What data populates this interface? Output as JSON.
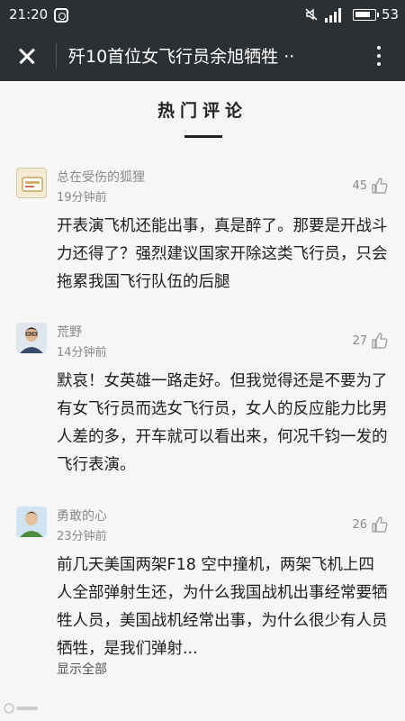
{
  "status_bar": {
    "time": "21:20",
    "battery": "53",
    "icons": [
      "app-icon",
      "mute-icon",
      "signal-icon",
      "battery-icon"
    ]
  },
  "header": {
    "title": "歼10首位女飞行员余旭牺牲 ··",
    "close_icon": "close-icon",
    "more_icon": "more-icon"
  },
  "section": {
    "heading": "热门评论"
  },
  "comments": [
    {
      "name": "总在受伤的狐狸",
      "time": "19分钟前",
      "likes": "45",
      "text": "开表演飞机还能出事，真是醉了。那要是开战斗力还得了？强烈建议国家开除这类飞行员，只会拖累我国飞行队伍的后腿"
    },
    {
      "name": "荒野",
      "time": "14分钟前",
      "likes": "27",
      "text": "默哀！女英雄一路走好。但我觉得还是不要为了有女飞行员而选女飞行员，女人的反应能力比男人差的多，开车就可以看出来，何况千钧一发的飞行表演。"
    },
    {
      "name": "勇敢的心",
      "time": "23分钟前",
      "likes": "26",
      "text": "前几天美国两架F18 空中撞机，两架飞机上四人全部弹射生还，为什么我国战机出事经常要牺牲人员，美国战机经常出事，为什么很少有人员牺牲，是我们弹射..."
    }
  ],
  "show_all": "显示全部",
  "colors": {
    "header_bg": "#2d3033",
    "page_bg": "#f6f6f6",
    "meta_text": "#8a8a8a"
  }
}
